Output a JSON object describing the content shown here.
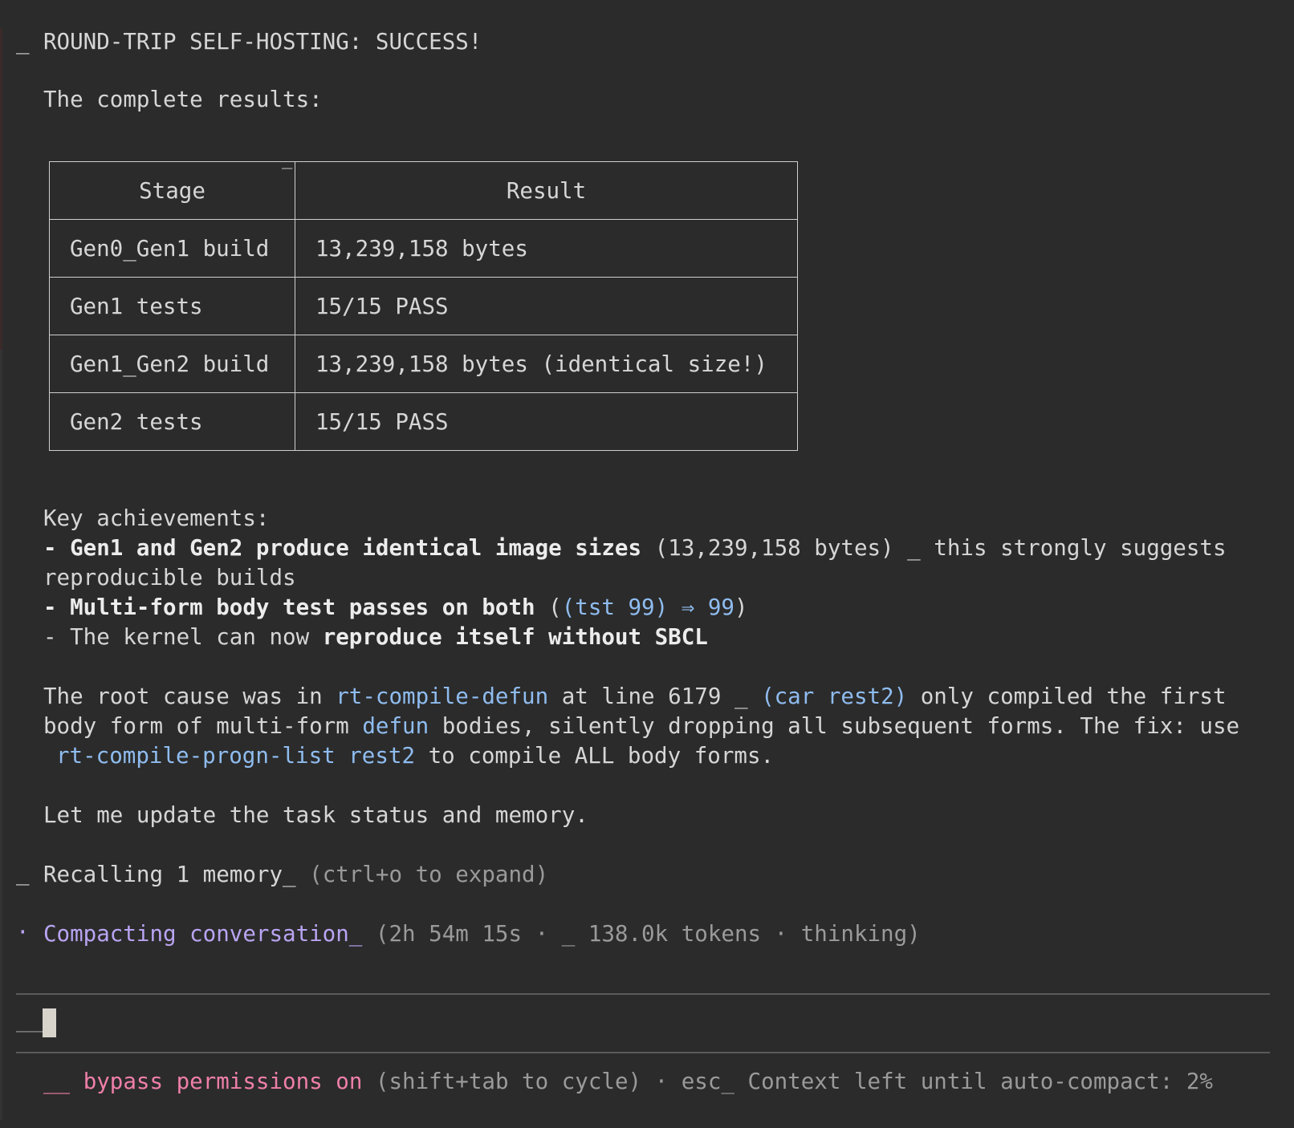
{
  "header": {
    "marker": "_",
    "title": "ROUND-TRIP SELF-HOSTING: SUCCESS!"
  },
  "intro": "The complete results:",
  "table": {
    "corner_mark": "_",
    "headers": [
      "Stage",
      "Result"
    ],
    "rows": [
      [
        "Gen0_Gen1 build",
        "13,239,158 bytes"
      ],
      [
        "Gen1 tests",
        "15/15 PASS"
      ],
      [
        "Gen1_Gen2 build",
        "13,239,158 bytes (identical size!)"
      ],
      [
        "Gen2 tests",
        "15/15 PASS"
      ]
    ]
  },
  "achievements": {
    "heading": "Key achievements:",
    "item1_bold": "- Gen1 and Gen2 produce identical image sizes",
    "item1_rest": " (13,239,158 bytes) _ this strongly suggests",
    "item1_cont": "reproducible builds",
    "item2_bold": "- Multi-form body test passes on both",
    "item2_paren_open": " (",
    "item2_code": "(tst 99) ⇒ 99",
    "item2_paren_close": ")",
    "item3_pre": "- The kernel can now ",
    "item3_bold": "reproduce itself without SBCL"
  },
  "root_cause": {
    "l1_a": "The root cause was in ",
    "l1_code1": "rt-compile-defun",
    "l1_b": " at line 6179 _ ",
    "l1_code2": "(car rest2)",
    "l1_c": " only compiled the first",
    "l2_a": "body form of multi-form ",
    "l2_code": "defun",
    "l2_b": " bodies, silently dropping all subsequent forms. The fix: use",
    "l3_code": "rt-compile-progn-list rest2",
    "l3_b": " to compile ALL body forms."
  },
  "update_line": "Let me update the task status and memory.",
  "recall": {
    "marker": "_",
    "text": "Recalling 1 memory_",
    "hint": " (ctrl+o to expand)"
  },
  "compacting": {
    "marker": "·",
    "text": "Compacting conversation_",
    "detail": " (2h 54m 15s · _ 138.0k tokens · thinking)"
  },
  "prompt": {
    "marker": "__"
  },
  "status_bar": {
    "marker": "__",
    "mode": "bypass permissions on",
    "hint": " (shift+tab to cycle) · esc_ Context left until auto-compact: 2%"
  },
  "colors": {
    "background": "#2b2b2b",
    "text": "#d6d6d6",
    "code": "#8fbcef",
    "compacting": "#b9a4f2",
    "bypass": "#ef7fa9"
  }
}
